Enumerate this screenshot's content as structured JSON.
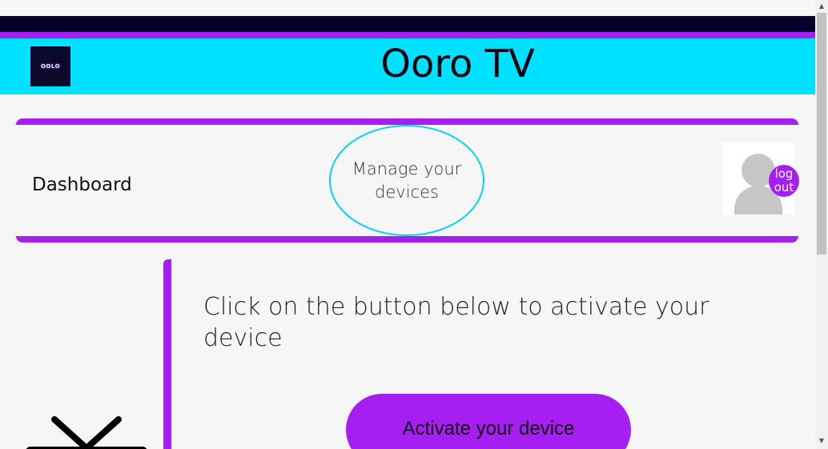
{
  "header": {
    "logo_text": "OOLO",
    "title": "Ooro TV"
  },
  "nav": {
    "dashboard_label": "Dashboard",
    "manage_label": "Manage your devices",
    "logout_label": "log out"
  },
  "main": {
    "instruction": "Click on the button below to activate your device",
    "activate_label": "Activate your device"
  },
  "icons": {
    "logo": "brand-logo",
    "avatar": "user-avatar-icon",
    "tv": "tv-icon",
    "scroll_up": "arrow-up-icon",
    "scroll_down": "arrow-down-icon"
  },
  "colors": {
    "accent_purple": "#a61ff2",
    "header_cyan": "#00e0ff",
    "top_dark": "#07002a"
  }
}
